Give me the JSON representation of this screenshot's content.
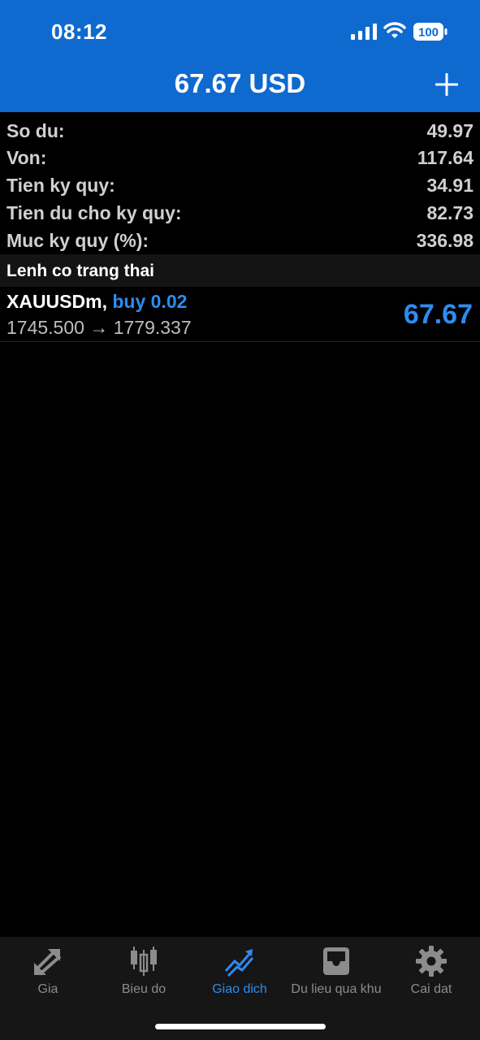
{
  "status_bar": {
    "time": "08:12",
    "battery": "100"
  },
  "header": {
    "title": "67.67 USD",
    "add_icon": "plus-icon"
  },
  "summary": [
    {
      "label": "So du:",
      "value": "49.97"
    },
    {
      "label": "Von:",
      "value": "117.64"
    },
    {
      "label": "Tien ky quy:",
      "value": "34.91"
    },
    {
      "label": "Tien du cho ky quy:",
      "value": "82.73"
    },
    {
      "label": "Muc ky quy (%):",
      "value": "336.98"
    }
  ],
  "positions_section": {
    "title": "Lenh co trang thai"
  },
  "positions": [
    {
      "symbol": "XAUUSDm,",
      "type": "buy 0.02",
      "prices": "1745.500 → 1779.337",
      "profit": "67.67"
    }
  ],
  "tabs": [
    {
      "label": "Gia",
      "icon": "arrows-icon",
      "active": false
    },
    {
      "label": "Bieu do",
      "icon": "candlestick-icon",
      "active": false
    },
    {
      "label": "Giao dich",
      "icon": "trade-chart-icon",
      "active": true
    },
    {
      "label": "Du lieu qua khu",
      "icon": "inbox-icon",
      "active": false
    },
    {
      "label": "Cai dat",
      "icon": "gear-icon",
      "active": false
    }
  ],
  "colors": {
    "header_bg": "#0f6ad0",
    "accent": "#2d8cf0",
    "background": "#000000"
  }
}
